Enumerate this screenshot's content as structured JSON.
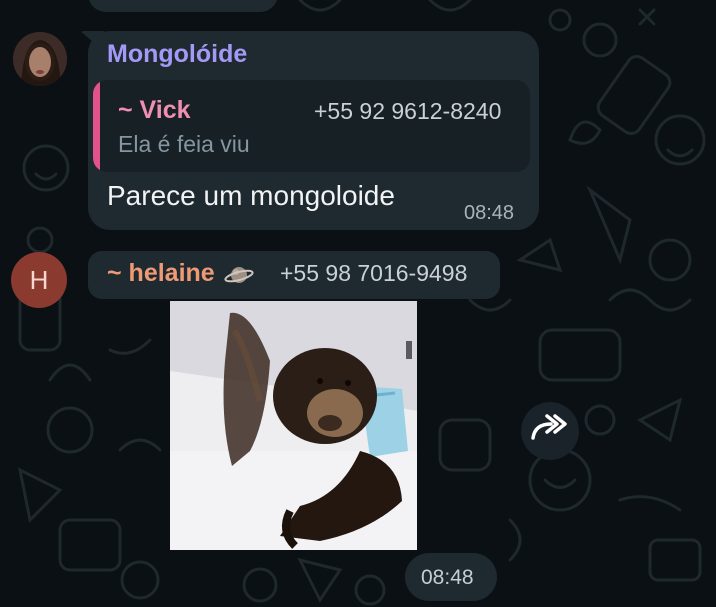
{
  "message1": {
    "sender": "Mongolóide",
    "quote": {
      "name": "~ Vick",
      "phone": "+55 92 9612-8240",
      "text": "Ela é feia viu"
    },
    "text": "Parece um mongoloide",
    "time": "08:48"
  },
  "message2": {
    "avatar_letter": "H",
    "sender_name": "~ helaine",
    "sender_emoji": "ringed-planet-icon",
    "sender_phone": "+55 98 7016-9498",
    "media_type": "image",
    "time": "08:48"
  },
  "actions": {
    "forward_icon": "forward-arrow-icon"
  },
  "colors": {
    "background": "#0b1014",
    "bubble": "#1f2a30",
    "sender1": "#a39af5",
    "quote_accent": "#e2538c",
    "sender2": "#ee9a74"
  }
}
